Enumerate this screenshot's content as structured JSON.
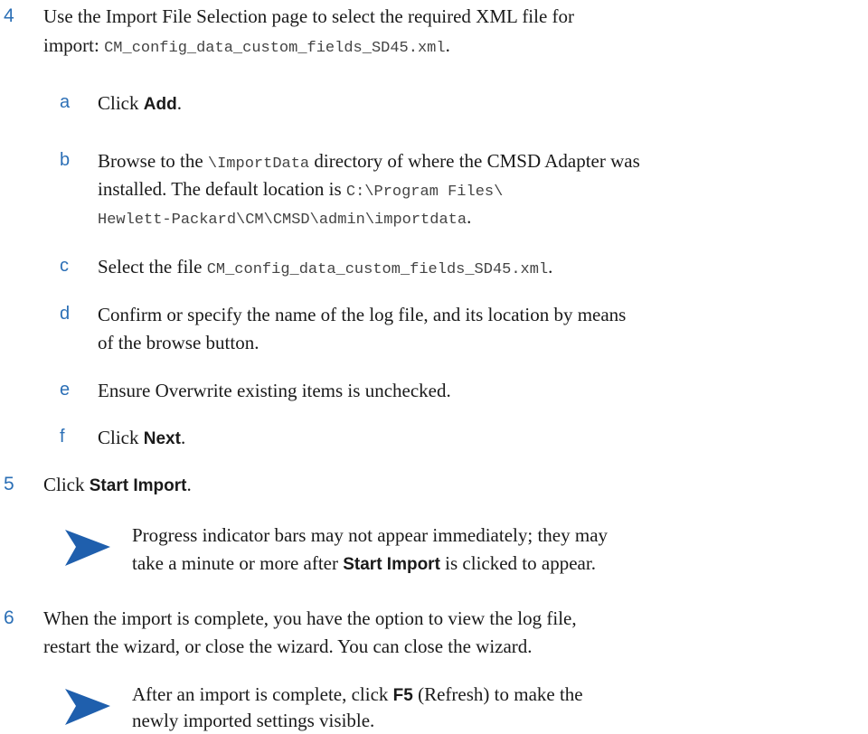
{
  "colors": {
    "step_number": "#2b6fb6",
    "note_icon": "#1f5fad",
    "mono_text": "#444444"
  },
  "steps": [
    {
      "number": "4",
      "line1": "Use the Import File Selection page to select the required XML file for",
      "line2_prefix": "import: ",
      "line2_code": "CM_config_data_custom_fields_SD45.xml",
      "line2_suffix": ".",
      "substeps": [
        {
          "letter": "a",
          "pre": "Click ",
          "ui": "Add",
          "post": "."
        },
        {
          "letter": "b",
          "line1_pre": "Browse to the ",
          "line1_code": "\\ImportData",
          "line1_post": " directory of where the CMSD Adapter was",
          "line2_pre": "installed. The default location is ",
          "line2_code": "C:\\Program Files\\",
          "line3_code": "Hewlett-Packard\\CM\\CMSD\\admin\\importdata",
          "line3_post": "."
        },
        {
          "letter": "c",
          "pre": "Select the file ",
          "code": "CM_config_data_custom_fields_SD45.xml",
          "post": "."
        },
        {
          "letter": "d",
          "line1": "Confirm or specify the name of the log file, and its location by means",
          "line2": "of the browse button."
        },
        {
          "letter": "e",
          "text": "Ensure Overwrite existing items is unchecked."
        },
        {
          "letter": "f",
          "pre": "Click ",
          "ui": "Next",
          "post": "."
        }
      ]
    },
    {
      "number": "5",
      "pre": "Click ",
      "ui": "Start Import",
      "post": ".",
      "note": {
        "icon": "note-arrow-icon",
        "line1": "Progress indicator bars may not appear immediately; they may",
        "line2_pre": "take a minute or more after ",
        "line2_ui": "Start Import",
        "line2_post": " is clicked to appear."
      }
    },
    {
      "number": "6",
      "line1": "When the import is complete, you have the option to view the log file,",
      "line2": "restart the wizard, or close the wizard. You can close the wizard.",
      "note": {
        "icon": "note-arrow-icon",
        "line1_pre": "After an import is complete, click ",
        "line1_ui": "F5",
        "line1_post": " (Refresh) to make the",
        "line2": "newly imported settings visible."
      }
    }
  ]
}
